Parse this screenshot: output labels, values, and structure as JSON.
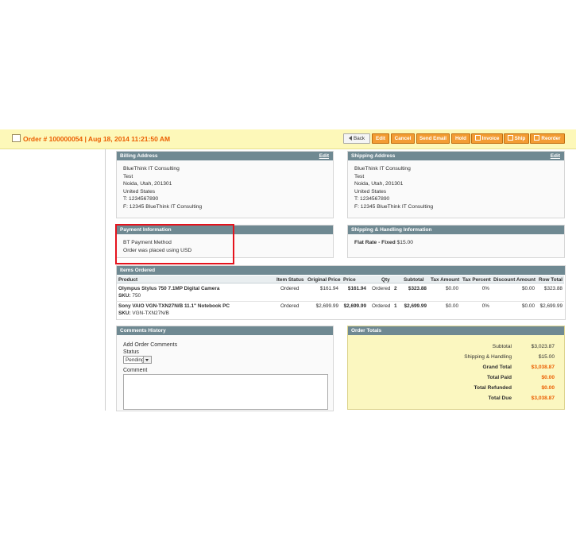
{
  "header": {
    "title": "Order # 100000054 | Aug 18, 2014 11:21:50 AM",
    "buttons": {
      "back": "Back",
      "edit": "Edit",
      "cancel": "Cancel",
      "send_email": "Send Email",
      "hold": "Hold",
      "invoice": "Invoice",
      "ship": "Ship",
      "reorder": "Reorder"
    }
  },
  "billing": {
    "title": "Billing Address",
    "edit": "Edit",
    "lines": [
      "BlueThink IT Consulting",
      "Test",
      "Noida, Utah, 201301",
      "United States",
      "T: 1234567890",
      "F: 12345 BlueThink IT Consulting"
    ]
  },
  "shipping": {
    "title": "Shipping Address",
    "edit": "Edit",
    "lines": [
      "BlueThink IT Consulting",
      "Test",
      "Noida, Utah, 201301",
      "United States",
      "T: 1234567890",
      "F: 12345 BlueThink IT Consulting"
    ]
  },
  "payment": {
    "title": "Payment Information",
    "method": "BT Payment Method",
    "currency_note": "Order was placed using USD"
  },
  "shipping_method": {
    "title": "Shipping & Handling Information",
    "label": "Flat Rate - Fixed",
    "price": "$15.00"
  },
  "items": {
    "title": "Items Ordered",
    "columns": [
      "Product",
      "Item Status",
      "Original Price",
      "Price",
      "Qty",
      "Subtotal",
      "Tax Amount",
      "Tax Percent",
      "Discount Amount",
      "Row Total"
    ],
    "rows": [
      {
        "name": "Olympus Stylus 750 7.1MP Digital Camera",
        "sku_label": "SKU:",
        "sku": "750",
        "status": "Ordered",
        "original_price": "$161.94",
        "price": "$161.94",
        "qty_label": "Ordered",
        "qty": "2",
        "subtotal": "$323.88",
        "tax_amount": "$0.00",
        "tax_percent": "0%",
        "discount": "$0.00",
        "row_total": "$323.88"
      },
      {
        "name": "Sony VAIO VGN-TXN27N/B 11.1\" Notebook PC",
        "sku_label": "SKU:",
        "sku": "VGN-TXN27N/B",
        "status": "Ordered",
        "original_price": "$2,699.99",
        "price": "$2,699.99",
        "qty_label": "Ordered",
        "qty": "1",
        "subtotal": "$2,699.99",
        "tax_amount": "$0.00",
        "tax_percent": "0%",
        "discount": "$0.00",
        "row_total": "$2,699.99"
      }
    ]
  },
  "comments": {
    "title": "Comments History",
    "add_label": "Add Order Comments",
    "status_label": "Status",
    "status_value": "Pending",
    "comment_label": "Comment"
  },
  "totals": {
    "title": "Order Totals",
    "subtotal_label": "Subtotal",
    "subtotal": "$3,023.87",
    "shipping_label": "Shipping & Handling",
    "shipping": "$15.00",
    "grand_label": "Grand Total",
    "grand": "$3,038.87",
    "paid_label": "Total Paid",
    "paid": "$0.00",
    "refunded_label": "Total Refunded",
    "refunded": "$0.00",
    "due_label": "Total Due",
    "due": "$3,038.87"
  },
  "colors": {
    "accent": "#eb5e00",
    "header_bg": "#fdf8b9",
    "box_header": "#6f8992",
    "highlight": "#e5131d"
  }
}
